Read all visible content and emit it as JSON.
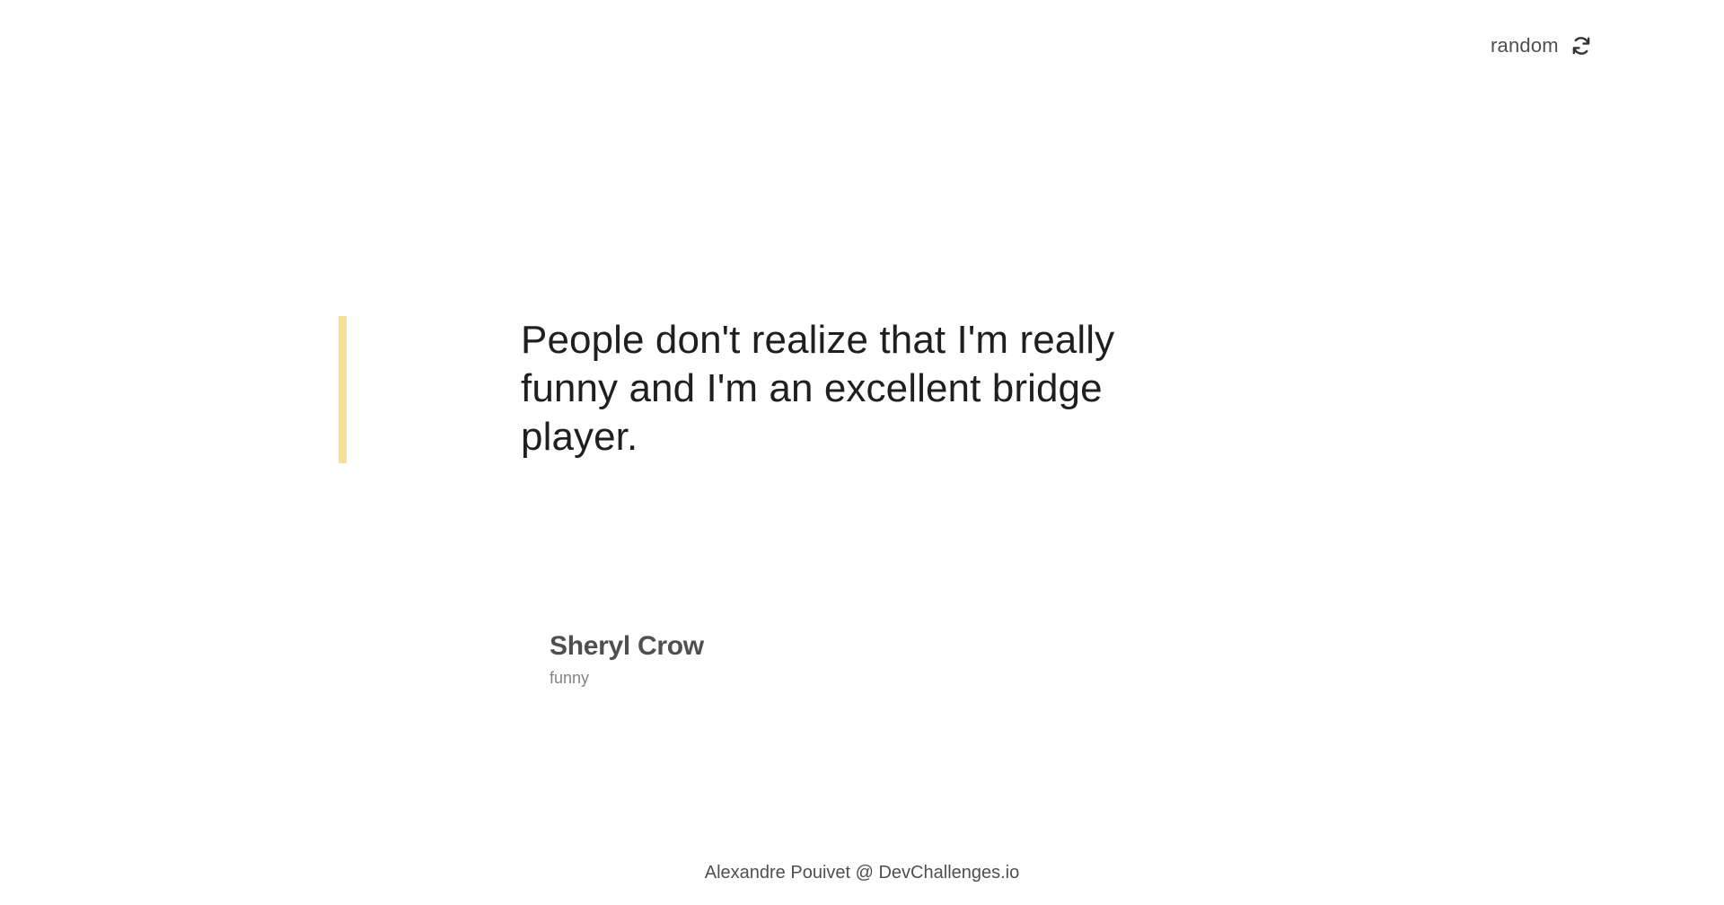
{
  "header": {
    "random_label": "random",
    "random_icon": "refresh-icon"
  },
  "quote": {
    "text": "People don't realize that I'm really funny and I'm an excellent bridge player.",
    "accent_color": "#F7DF94"
  },
  "author": {
    "name": "Sheryl Crow",
    "genre": "funny"
  },
  "footer": {
    "credit": "Alexandre Pouivet @ DevChallenges.io"
  }
}
